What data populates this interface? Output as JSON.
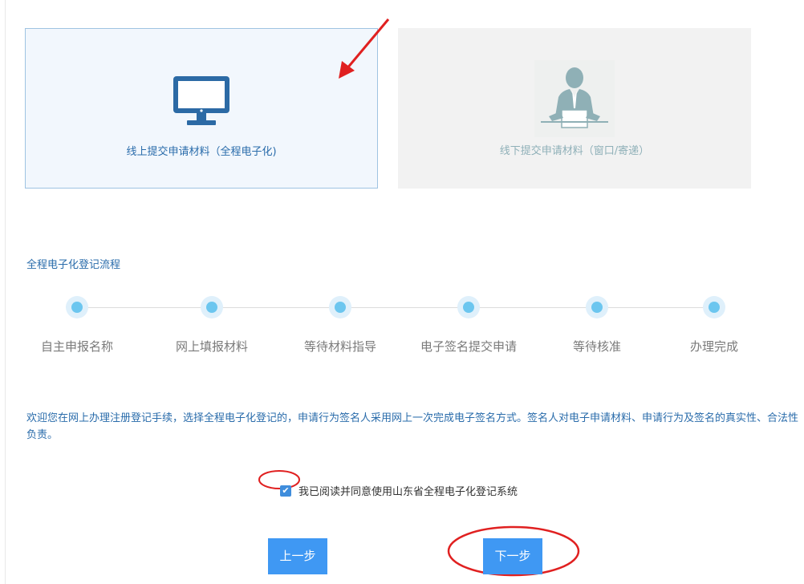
{
  "options": {
    "online_label": "线上提交申请材料（全程电子化)",
    "offline_label": "线下提交申请材料（窗口/寄递）"
  },
  "flow": {
    "title": "全程电子化登记流程",
    "steps": [
      "自主申报名称",
      "网上填报材料",
      "等待材料指导",
      "电子签名提交申请",
      "等待核准",
      "办理完成"
    ]
  },
  "notice": "欢迎您在网上办理注册登记手续，选择全程电子化登记的，申请行为签名人采用网上一次完成电子签名方式。签名人对电子申请材料、申请行为及签名的真实性、合法性负责。",
  "agreement": {
    "checked": true,
    "label": "我已阅读并同意使用山东省全程电子化登记系统"
  },
  "buttons": {
    "prev": "上一步",
    "next": "下一步"
  },
  "colors": {
    "accent": "#3f98f3",
    "link_text": "#2a6cab",
    "annotation": "#e02020"
  },
  "icons": {
    "online": "monitor-icon",
    "offline": "person-at-desk-icon"
  }
}
